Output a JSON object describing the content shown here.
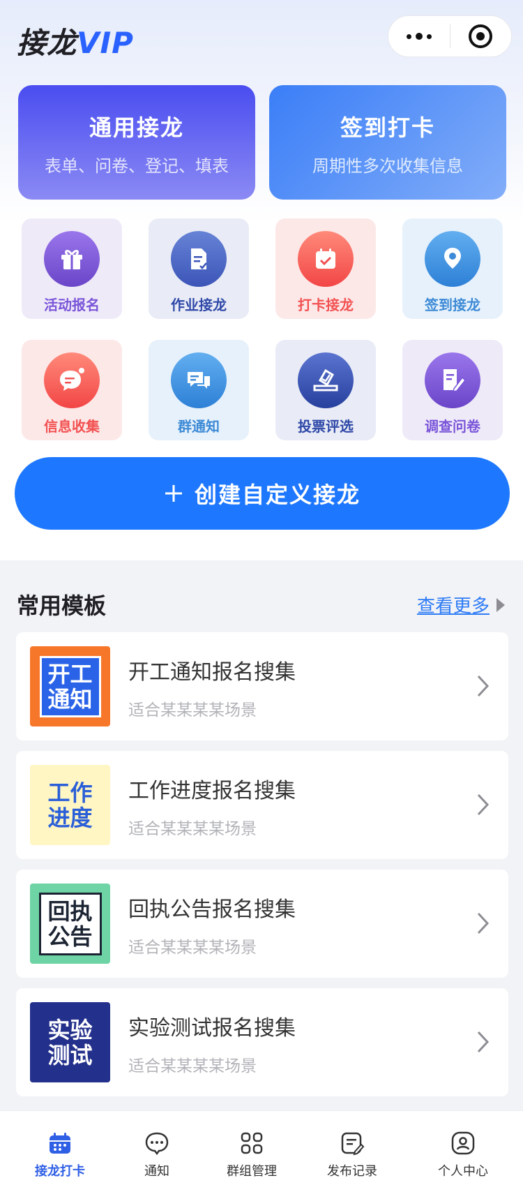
{
  "header": {
    "title_main": "接龙",
    "title_vip": "VIP"
  },
  "capsule": {
    "more_icon": "more-dots-icon",
    "close_icon": "target-icon"
  },
  "big_cards": [
    {
      "title": "通用接龙",
      "subtitle": "表单、问卷、登记、填表",
      "color": "#4a4df0"
    },
    {
      "title": "签到打卡",
      "subtitle": "周期性多次收集信息",
      "color": "#3a7ef7"
    }
  ],
  "tiles": [
    {
      "label": "活动报名",
      "icon": "gift-icon",
      "color": "#7a55d9"
    },
    {
      "label": "作业接龙",
      "icon": "document-check-icon",
      "color": "#3c55b8"
    },
    {
      "label": "打卡接龙",
      "icon": "calendar-check-icon",
      "color": "#f25252"
    },
    {
      "label": "签到接龙",
      "icon": "location-pin-icon",
      "color": "#3d8ad6"
    },
    {
      "label": "信息收集",
      "icon": "message-bubble-icon",
      "color": "#f25252"
    },
    {
      "label": "群通知",
      "icon": "chat-bubbles-icon",
      "color": "#3d8ad6"
    },
    {
      "label": "投票评选",
      "icon": "ballot-icon",
      "color": "#2f48a8"
    },
    {
      "label": "调查问卷",
      "icon": "edit-form-icon",
      "color": "#7a55d9"
    }
  ],
  "create_button": {
    "label": "创建自定义接龙",
    "icon": "plus-icon"
  },
  "templates_section": {
    "title": "常用模板",
    "more_label": "查看更多"
  },
  "templates": [
    {
      "name": "开工通知报名搜集",
      "desc": "适合某某某某场景",
      "thumb_text": "开工通知"
    },
    {
      "name": "工作进度报名搜集",
      "desc": "适合某某某某场景",
      "thumb_text": "工作进度"
    },
    {
      "name": "回执公告报名搜集",
      "desc": "适合某某某某场景",
      "thumb_text": "回执公告"
    },
    {
      "name": "实验测试报名搜集",
      "desc": "适合某某某某场景",
      "thumb_text": "实验测试"
    }
  ],
  "tabbar": [
    {
      "label": "接龙打卡",
      "icon": "calendar-icon",
      "active": true
    },
    {
      "label": "通知",
      "icon": "chat-icon",
      "active": false
    },
    {
      "label": "群组管理",
      "icon": "grid-icon",
      "active": false
    },
    {
      "label": "发布记录",
      "icon": "record-icon",
      "active": false
    },
    {
      "label": "个人中心",
      "icon": "user-icon",
      "active": false
    }
  ],
  "colors": {
    "primary": "#1e78ff",
    "active_tab": "#2f5fe5",
    "link": "#2f7cf6"
  }
}
